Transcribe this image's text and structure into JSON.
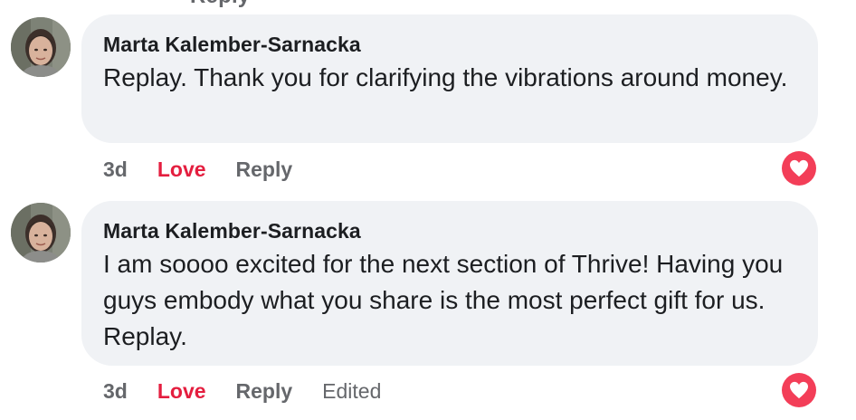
{
  "top_cutoff_text": "Reply",
  "comments": [
    {
      "author": "Marta Kalember-Sarnacka",
      "text": "Replay. Thank you for clarifying the vibrations around money.",
      "time": "3d",
      "like_label": "Love",
      "reply_label": "Reply",
      "edited_label": "",
      "reaction_icon": "love-reaction-icon"
    },
    {
      "author": "Marta Kalember-Sarnacka",
      "text": "I am soooo excited for the next section of Thrive! Having you guys embody what you share is the most perfect gift for us. Replay.",
      "time": "3d",
      "like_label": "Love",
      "reply_label": "Reply",
      "edited_label": "Edited",
      "reaction_icon": "love-reaction-icon"
    }
  ],
  "colors": {
    "bubble": "#f0f2f5",
    "love": "#e41e3f",
    "meta": "#65676b",
    "heart_badge": "#f33e58"
  }
}
